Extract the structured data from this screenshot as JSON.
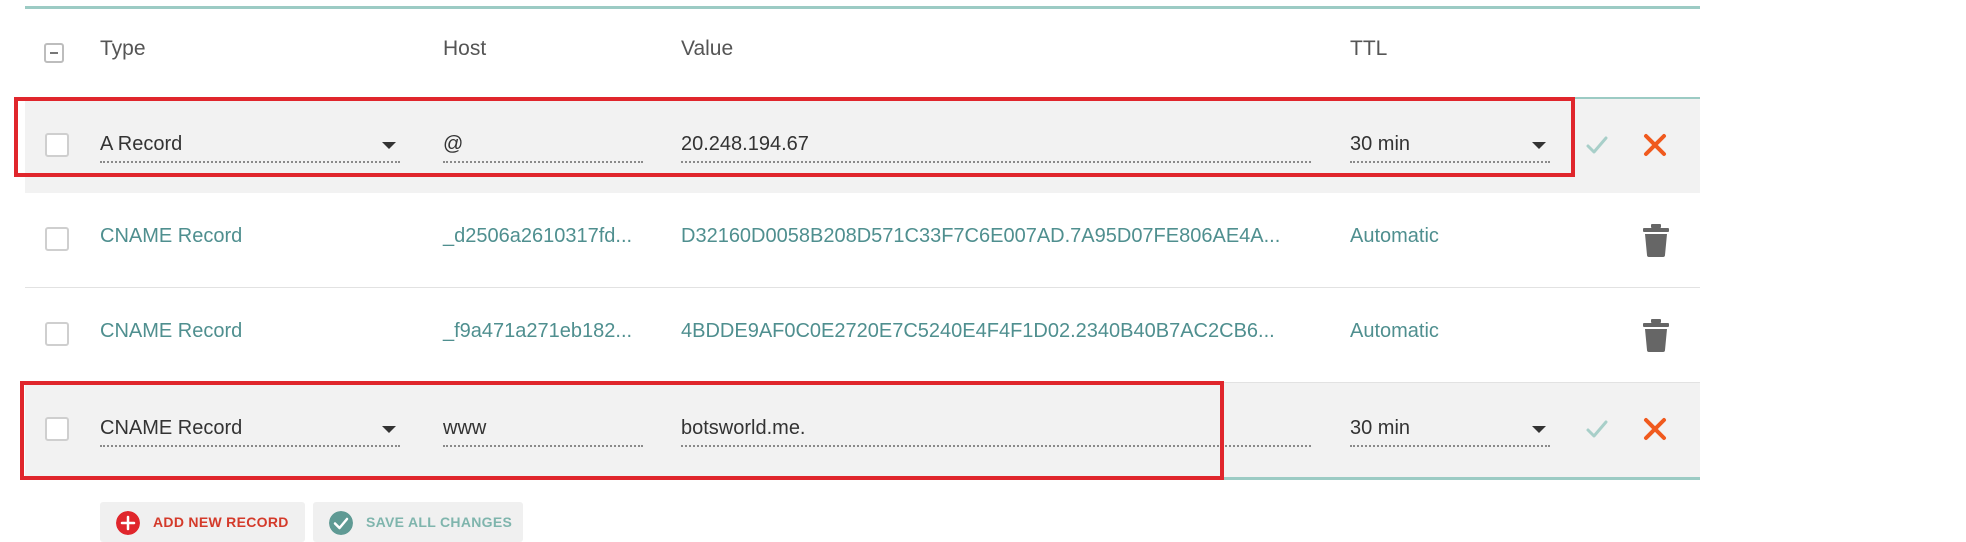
{
  "header": {
    "type_label": "Type",
    "host_label": "Host",
    "value_label": "Value",
    "ttl_label": "TTL"
  },
  "records": [
    {
      "type": "A Record",
      "host": "@",
      "value": "20.248.194.67",
      "ttl": "30 min",
      "mode": "edit"
    },
    {
      "type": "CNAME Record",
      "host": "_d2506a2610317fd...",
      "value": "D32160D0058B208D571C33F7C6E007AD.7A95D07FE806AE4A...",
      "ttl": "Automatic",
      "mode": "view"
    },
    {
      "type": "CNAME Record",
      "host": "_f9a471a271eb182...",
      "value": "4BDDE9AF0C0E2720E7C5240E4F4F1D02.2340B40B7AC2CB6...",
      "ttl": "Automatic",
      "mode": "view"
    },
    {
      "type": "CNAME Record",
      "host": "www",
      "value": "botsworld.me.",
      "ttl": "30 min",
      "mode": "edit"
    }
  ],
  "actions": {
    "add_label": "ADD NEW RECORD",
    "save_label": "SAVE ALL CHANGES"
  },
  "colors": {
    "accent_teal": "#9ccbc4",
    "link_teal": "#4f8f8f",
    "add_red": "#e0262c",
    "close_orange": "#f05a1e",
    "highlight_red": "#e0262c"
  },
  "icons": [
    "select-all-checkbox",
    "caret-down-icon",
    "check-icon",
    "close-icon",
    "trash-icon",
    "plus-icon"
  ]
}
